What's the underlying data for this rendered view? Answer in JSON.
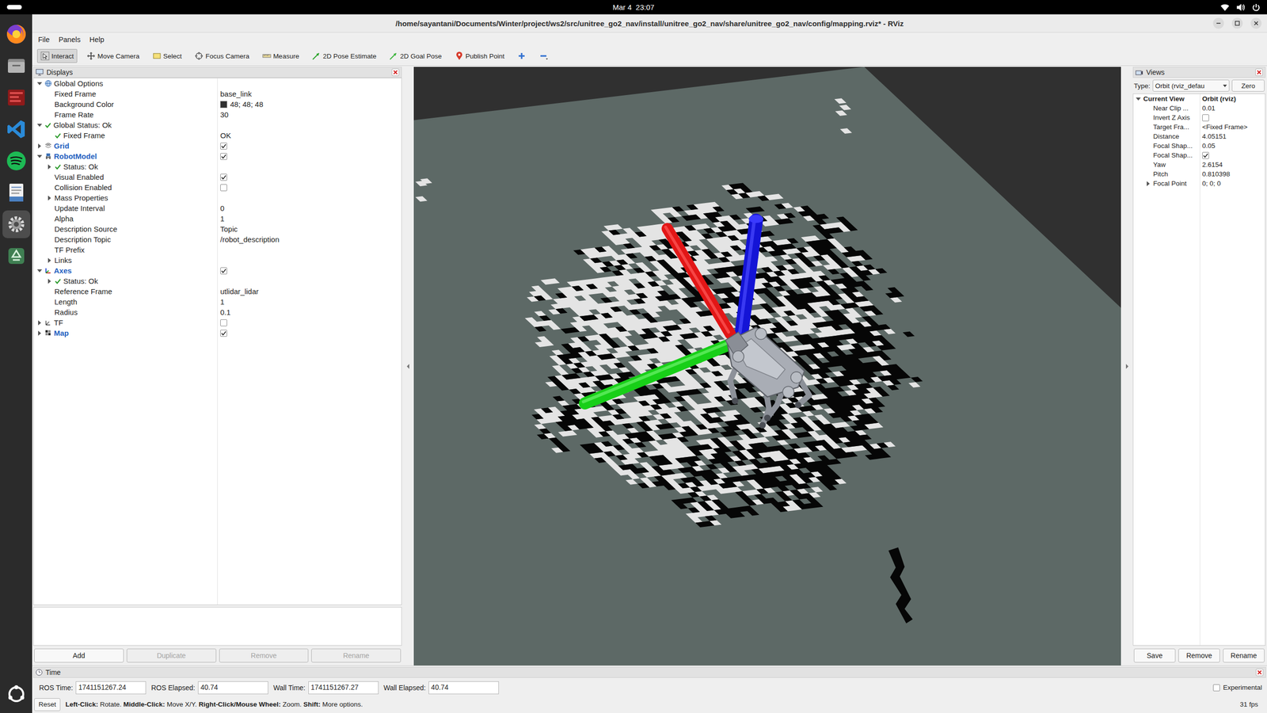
{
  "topbar": {
    "clock": "Mar 4  23:07"
  },
  "dock": [
    {
      "selected": false
    },
    {
      "selected": false
    },
    {
      "selected": false
    },
    {
      "selected": false
    },
    {
      "selected": false
    },
    {
      "selected": false
    },
    {
      "selected": true
    },
    {
      "selected": false
    }
  ],
  "window": {
    "title": "/home/sayantani/Documents/Winter/project/ws2/src/unitree_go2_nav/install/unitree_go2_nav/share/unitree_go2_nav/config/mapping.rviz* - RViz"
  },
  "menu": [
    "File",
    "Panels",
    "Help"
  ],
  "toolbar": [
    {
      "label": "Interact",
      "selected": true
    },
    {
      "label": "Move Camera",
      "selected": false
    },
    {
      "label": "Select",
      "selected": false
    },
    {
      "label": "Focus Camera",
      "selected": false
    },
    {
      "label": "Measure",
      "selected": false
    },
    {
      "label": "2D Pose Estimate",
      "selected": false
    },
    {
      "label": "2D Goal Pose",
      "selected": false
    },
    {
      "label": "Publish Point",
      "selected": false
    }
  ],
  "displays": {
    "title": "Displays",
    "tree": [
      {
        "label": "Global Options",
        "kind": "group",
        "expanded": true,
        "children": [
          {
            "label": "Fixed Frame",
            "kind": "property",
            "value": "base_link"
          },
          {
            "label": "Background Color",
            "kind": "property",
            "value": "48; 48; 48",
            "color": "#303030"
          },
          {
            "label": "Frame Rate",
            "kind": "property",
            "value": "30"
          }
        ]
      },
      {
        "label": "Global Status: Ok",
        "kind": "status",
        "expanded": true,
        "children": [
          {
            "label": "Fixed Frame",
            "kind": "status",
            "value": "OK"
          }
        ]
      },
      {
        "label": "Grid",
        "kind": "display",
        "checked": true,
        "expanded": false
      },
      {
        "label": "RobotModel",
        "kind": "display",
        "checked": true,
        "expanded": true,
        "children": [
          {
            "label": "Status: Ok",
            "kind": "status",
            "expanded": false
          },
          {
            "label": "Visual Enabled",
            "kind": "property",
            "checked": true
          },
          {
            "label": "Collision Enabled",
            "kind": "property",
            "checked": false
          },
          {
            "label": "Mass Properties",
            "kind": "property",
            "expanded": false
          },
          {
            "label": "Update Interval",
            "kind": "property",
            "value": "0"
          },
          {
            "label": "Alpha",
            "kind": "property",
            "value": "1"
          },
          {
            "label": "Description Source",
            "kind": "property",
            "value": "Topic"
          },
          {
            "label": "Description Topic",
            "kind": "property",
            "value": "/robot_description"
          },
          {
            "label": "TF Prefix",
            "kind": "property",
            "value": ""
          },
          {
            "label": "Links",
            "kind": "property",
            "expanded": false
          }
        ]
      },
      {
        "label": "Axes",
        "kind": "display",
        "checked": true,
        "expanded": true,
        "children": [
          {
            "label": "Status: Ok",
            "kind": "status",
            "expanded": false
          },
          {
            "label": "Reference Frame",
            "kind": "property",
            "value": "utlidar_lidar"
          },
          {
            "label": "Length",
            "kind": "property",
            "value": "1"
          },
          {
            "label": "Radius",
            "kind": "property",
            "value": "0.1"
          }
        ]
      },
      {
        "label": "TF",
        "kind": "display",
        "checked": false,
        "expanded": false
      },
      {
        "label": "Map",
        "kind": "display",
        "checked": true,
        "expanded": false
      }
    ],
    "buttons": [
      {
        "label": "Add",
        "disabled": false
      },
      {
        "label": "Duplicate",
        "disabled": true
      },
      {
        "label": "Remove",
        "disabled": true
      },
      {
        "label": "Rename",
        "disabled": true
      }
    ]
  },
  "views": {
    "title": "Views",
    "type_label": "Type:",
    "type_value": "Orbit (rviz_defau",
    "zero": "Zero",
    "tree": [
      {
        "label": "Current View",
        "kind": "header",
        "value": "Orbit (rviz)",
        "expanded": true,
        "children": [
          {
            "label": "Near Clip ...",
            "kind": "property",
            "value": "0.01"
          },
          {
            "label": "Invert Z Axis",
            "kind": "property",
            "checked": false
          },
          {
            "label": "Target Fra...",
            "kind": "property",
            "value": "<Fixed Frame>"
          },
          {
            "label": "Distance",
            "kind": "property",
            "value": "4.05151"
          },
          {
            "label": "Focal Shap...",
            "kind": "property",
            "value": "0.05"
          },
          {
            "label": "Focal Shap...",
            "kind": "property",
            "checked": true
          },
          {
            "label": "Yaw",
            "kind": "property",
            "value": "2.6154"
          },
          {
            "label": "Pitch",
            "kind": "property",
            "value": "0.810398"
          },
          {
            "label": "Focal Point",
            "kind": "property",
            "value": "0; 0; 0",
            "expanded": false
          }
        ]
      }
    ],
    "buttons": [
      "Save",
      "Remove",
      "Rename"
    ]
  },
  "time": {
    "title": "Time",
    "fields": [
      {
        "label": "ROS Time:",
        "value": "1741151267.24"
      },
      {
        "label": "ROS Elapsed:",
        "value": "40.74"
      },
      {
        "label": "Wall Time:",
        "value": "1741151267.27"
      },
      {
        "label": "Wall Elapsed:",
        "value": "40.74"
      }
    ],
    "experimental": {
      "label": "Experimental",
      "checked": false
    },
    "reset": "Reset",
    "hint": [
      {
        "text": "Left-Click:",
        "bold": true
      },
      {
        "text": " Rotate. ",
        "bold": false
      },
      {
        "text": "Middle-Click:",
        "bold": true
      },
      {
        "text": " Move X/Y. ",
        "bold": false
      },
      {
        "text": "Right-Click/Mouse Wheel:",
        "bold": true
      },
      {
        "text": " Zoom. ",
        "bold": false
      },
      {
        "text": "Shift:",
        "bold": true
      },
      {
        "text": " More options.",
        "bold": false
      }
    ],
    "fps": "31 fps"
  }
}
